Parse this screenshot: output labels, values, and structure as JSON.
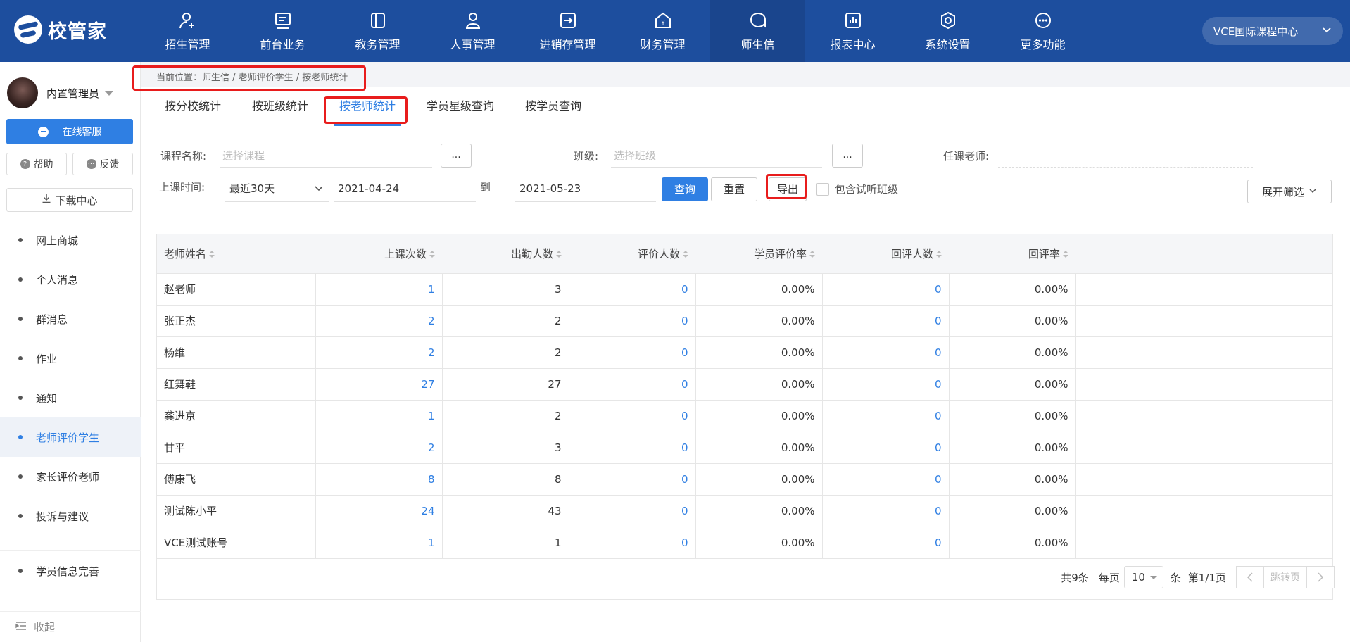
{
  "brand": {
    "name": "校管家"
  },
  "nav": [
    {
      "label": "招生管理",
      "icon": "user-add-icon"
    },
    {
      "label": "前台业务",
      "icon": "monitor-icon"
    },
    {
      "label": "教务管理",
      "icon": "book-icon"
    },
    {
      "label": "人事管理",
      "icon": "person-icon"
    },
    {
      "label": "进销存管理",
      "icon": "transfer-icon"
    },
    {
      "label": "财务管理",
      "icon": "finance-house-icon"
    },
    {
      "label": "师生信",
      "icon": "chat-icon",
      "active": true
    },
    {
      "label": "报表中心",
      "icon": "report-icon"
    },
    {
      "label": "系统设置",
      "icon": "settings-icon"
    },
    {
      "label": "更多功能",
      "icon": "more-icon"
    }
  ],
  "campus": {
    "label": "VCE国际课程中心"
  },
  "user": {
    "name": "内置管理员"
  },
  "sidebar": {
    "service_label": "在线客服",
    "help_label": "帮助",
    "feedback_label": "反馈",
    "download_label": "下载中心",
    "menu": [
      "网上商城",
      "个人消息",
      "群消息",
      "作业",
      "通知",
      "老师评价学生",
      "家长评价老师",
      "投诉与建议"
    ],
    "active_index": 5,
    "extra_menu": "学员信息完善",
    "collapse_label": "收起"
  },
  "breadcrumb": "当前位置：师生信 / 老师评价学生 / 按老师统计",
  "tabs": [
    {
      "label": "按分校统计"
    },
    {
      "label": "按班级统计"
    },
    {
      "label": "按老师统计",
      "active": true
    },
    {
      "label": "学员星级查询"
    },
    {
      "label": "按学员查询"
    }
  ],
  "filters": {
    "course_label": "课程名称:",
    "course_placeholder": "选择课程",
    "class_label": "班级:",
    "class_placeholder": "选择班级",
    "teacher_label": "任课老师:",
    "dots": "...",
    "time_label": "上课时间:",
    "time_range": "最近30天",
    "date_from": "2021-04-24",
    "to_label": "到",
    "date_to": "2021-05-23",
    "query_label": "查询",
    "reset_label": "重置",
    "export_label": "导出",
    "trial_label": "包含试听班级",
    "expand_label": "展开筛选"
  },
  "table": {
    "columns": [
      "老师姓名",
      "上课次数",
      "出勤人数",
      "评价人数",
      "学员评价率",
      "回评人数",
      "回评率"
    ],
    "rows": [
      [
        "赵老师",
        "1",
        "3",
        "0",
        "0.00%",
        "0",
        "0.00%"
      ],
      [
        "张正杰",
        "2",
        "2",
        "0",
        "0.00%",
        "0",
        "0.00%"
      ],
      [
        "杨维",
        "2",
        "2",
        "0",
        "0.00%",
        "0",
        "0.00%"
      ],
      [
        "红舞鞋",
        "27",
        "27",
        "0",
        "0.00%",
        "0",
        "0.00%"
      ],
      [
        "龚进京",
        "1",
        "2",
        "0",
        "0.00%",
        "0",
        "0.00%"
      ],
      [
        "甘平",
        "2",
        "3",
        "0",
        "0.00%",
        "0",
        "0.00%"
      ],
      [
        "傅康飞",
        "8",
        "8",
        "0",
        "0.00%",
        "0",
        "0.00%"
      ],
      [
        "测试陈小平",
        "24",
        "43",
        "0",
        "0.00%",
        "0",
        "0.00%"
      ],
      [
        "VCE测试账号",
        "1",
        "1",
        "0",
        "0.00%",
        "0",
        "0.00%"
      ]
    ]
  },
  "pager": {
    "total": "共9条",
    "per_page_label": "每页",
    "per_page": "10",
    "unit": "条",
    "page_info": "第1/1页",
    "jump_label": "跳转页"
  },
  "colors": {
    "topbar": "#1d4e9e",
    "accent": "#2f7fe3",
    "highlight": "#e81c1c"
  }
}
